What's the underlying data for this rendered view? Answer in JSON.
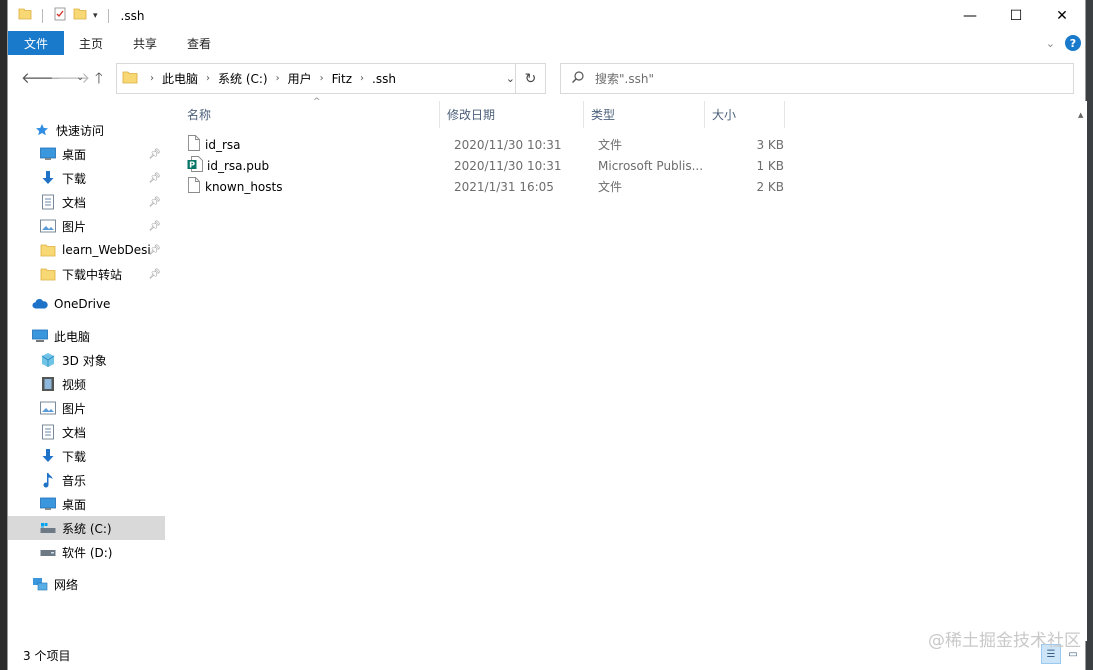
{
  "window": {
    "title": ".ssh",
    "minimize_glyph": "—",
    "maximize_glyph": "☐",
    "close_glyph": "✕"
  },
  "ribbon": {
    "tabs": [
      "文件",
      "主页",
      "共享",
      "查看"
    ],
    "expand_glyph": "⌄",
    "help_glyph": "?"
  },
  "address": {
    "crumbs": [
      "此电脑",
      "系统 (C:)",
      "用户",
      "Fitz",
      ".ssh"
    ],
    "search_placeholder": "搜索\".ssh\""
  },
  "sidebar": {
    "items": [
      {
        "label": "快速访问",
        "icon": "star-icon",
        "pinned": false
      },
      {
        "label": "桌面",
        "icon": "desktop-icon",
        "pinned": true
      },
      {
        "label": "下载",
        "icon": "download-icon",
        "pinned": true
      },
      {
        "label": "文档",
        "icon": "document-icon",
        "pinned": true
      },
      {
        "label": "图片",
        "icon": "picture-icon",
        "pinned": true
      },
      {
        "label": "learn_WebDesi",
        "icon": "folder-icon",
        "pinned": true
      },
      {
        "label": "下载中转站",
        "icon": "folder-icon",
        "pinned": true
      },
      {
        "label": "OneDrive",
        "icon": "cloud-icon",
        "pinned": false
      },
      {
        "label": "此电脑",
        "icon": "computer-icon",
        "pinned": false
      },
      {
        "label": "3D 对象",
        "icon": "cube-icon",
        "pinned": false
      },
      {
        "label": "视频",
        "icon": "video-icon",
        "pinned": false
      },
      {
        "label": "图片",
        "icon": "picture-icon",
        "pinned": false
      },
      {
        "label": "文档",
        "icon": "document-icon",
        "pinned": false
      },
      {
        "label": "下载",
        "icon": "download-icon",
        "pinned": false
      },
      {
        "label": "音乐",
        "icon": "music-icon",
        "pinned": false
      },
      {
        "label": "桌面",
        "icon": "desktop-icon",
        "pinned": false
      },
      {
        "label": "系统 (C:)",
        "icon": "drive-c-icon",
        "pinned": false,
        "selected": true
      },
      {
        "label": "软件 (D:)",
        "icon": "drive-icon",
        "pinned": false
      },
      {
        "label": "网络",
        "icon": "network-icon",
        "pinned": false
      }
    ]
  },
  "columns": {
    "name": "名称",
    "date": "修改日期",
    "type": "类型",
    "size": "大小"
  },
  "files": [
    {
      "name": "id_rsa",
      "date": "2020/11/30 10:31",
      "type": "文件",
      "size": "3 KB",
      "icon": "file-icon"
    },
    {
      "name": "id_rsa.pub",
      "date": "2020/11/30 10:31",
      "type": "Microsoft Publis...",
      "size": "1 KB",
      "icon": "publisher-file-icon"
    },
    {
      "name": "known_hosts",
      "date": "2021/1/31 16:05",
      "type": "文件",
      "size": "2 KB",
      "icon": "file-icon"
    }
  ],
  "status": {
    "item_count": "3 个项目"
  },
  "watermark": "@稀土掘金技术社区",
  "colors": {
    "accent": "#1979ca",
    "selected_bg": "#d9d9d9",
    "header_text": "#4c607a"
  }
}
